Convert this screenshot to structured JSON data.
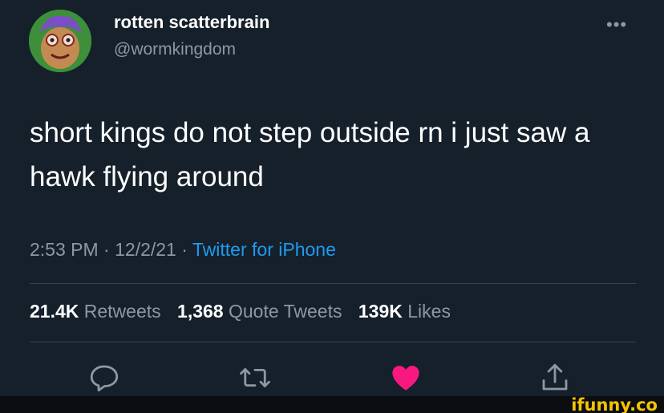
{
  "tweet": {
    "display_name": "rotten scatterbrain",
    "handle": "@wormkingdom",
    "text": "short kings do not step outside rn i just saw a hawk flying around",
    "time": "2:53 PM",
    "date": "12/2/21",
    "separator": "·",
    "source": "Twitter for iPhone",
    "avatar_icon": "cartoon-face-avatar"
  },
  "stats": {
    "retweets_count": "21.4K",
    "retweets_label": "Retweets",
    "quote_count": "1,368",
    "quote_label": "Quote Tweets",
    "likes_count": "139K",
    "likes_label": "Likes"
  },
  "actions": [
    {
      "icon": "reply-icon"
    },
    {
      "icon": "retweet-icon"
    },
    {
      "icon": "like-icon",
      "color": "#f91880",
      "active": true
    },
    {
      "icon": "share-icon"
    }
  ],
  "colors": {
    "background": "#15202b",
    "secondary_text": "#8b98a5",
    "link": "#1d9bf0",
    "like": "#f91880",
    "divider": "#38444d"
  },
  "watermark": {
    "text": "ifunny.co"
  }
}
